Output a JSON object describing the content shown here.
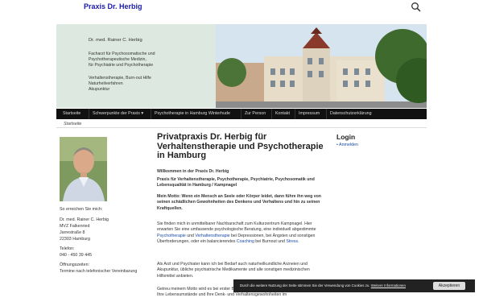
{
  "site": {
    "title": "Praxis Dr. Herbig"
  },
  "header": {
    "name": "Dr. med. Rainer C. Herbig",
    "line1": "Facharzt für Psychosomatische und",
    "line2": "Psychotherapeutische Medizin,",
    "line3": "für Psychiatrie und Psychotherapie",
    "line4": "Verhaltenstherapie, Burn-out Hilfe",
    "line5": "Naturheilverfahren",
    "line6": "Akupunktur"
  },
  "nav": {
    "items": [
      "Startseite",
      "Schwerpunkte der Praxis ▾",
      "Psychotherapie in Hamburg Winterhude",
      "Zur Person",
      "Kontakt",
      "Impressum",
      "Datenschutzerklärung"
    ]
  },
  "breadcrumb": "Startseite",
  "sidebar": {
    "intro": "So erreichen Sie mich:",
    "name": "Dr. med. Rainer C. Herbig",
    "org": "MVZ Falkenried",
    "street": "Jarrestraße 8",
    "city": "22303 Hamburg",
    "phone_label": "Telefon:",
    "phone": "040 - 450 39 445",
    "hours_label": "Öffnungszeiten:",
    "hours": "Termine nach telefonischer Vereinbarung"
  },
  "main": {
    "title": "Privatpraxis Dr. Herbig für Verhaltenstherapie und Psychotherapie in Hamburg",
    "welcome": "Willkommen in der Praxis Dr. Herbig",
    "subtitle": "Praxis für Verhaltenstherapie, Psychotherapie, Psychiatrie, Psychosomatik und Lebensqualität in Hamburg / Kampnagel",
    "motto": "Mein Motto: Wenn ein Mensch an Seele oder Körper leidet, dann führe ihn weg von seinen schädlichen Gewohnheiten des Denkens und Verhaltens und hin zu seinen Kraftquellen.",
    "p1_a": "Sie finden mich in unmittelbarer Nachbarschaft zum Kulturzentrum Kampnagel. Hier erwarten Sie eine umfassende psychologische Beratung, eine individuell abgestimmte ",
    "p1_link1": "Psychotherapie",
    "p1_b": " und ",
    "p1_link2": "Verhaltenstherapie",
    "p1_c": " bei Depressionen, bei Ängsten und sonstigen Überforderungen, oder ein balancierendes ",
    "p1_link3": "Coaching",
    "p1_d": " bei Burnout und ",
    "p1_link4": "Stress",
    "p1_e": ".",
    "p2": "Als Arzt und Psychiater kann ich bei Bedarf auch naturheilkundliche Arzneien und Akupunktur, übliche psychiatrische Medikamente und alle sonstigen medizinischen Hilfsmittel anbieten.",
    "p3": "Getreu meinem Motto wird es bei erster Behandlung hilfreich sein zu erkennen, wie Sie Ihre Lebensumstände und Ihre Denk- und Verhaltensgewohnheiten im"
  },
  "login": {
    "title": "Login",
    "link": "Anmelden"
  },
  "cookie": {
    "text": "Durch die weitere Nutzung der Seite stimmen Sie der Verwendung von Cookies zu.",
    "more": "Weitere Informationen",
    "accept": "Akzeptieren"
  }
}
